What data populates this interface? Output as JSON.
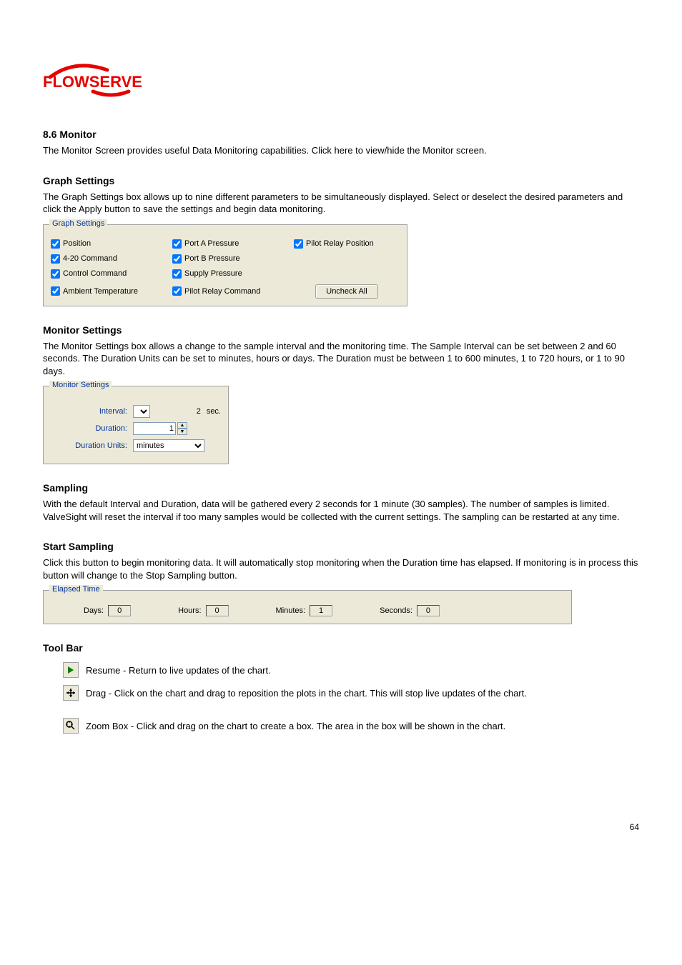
{
  "doc": {
    "section8_6_title": "8.6 Monitor",
    "intro": "The Monitor Screen provides useful Data Monitoring capabilities. Click here to view/hide the Monitor screen.",
    "graph_title": "Graph Settings",
    "graph_text": "The Graph Settings box allows up to nine different parameters to be simultaneously displayed. Select or deselect the desired parameters and click the Apply button to save the settings and begin data monitoring."
  },
  "graph": {
    "legend": "Graph Settings",
    "items": [
      {
        "label": "Position",
        "checked": true,
        "name": "chk-position"
      },
      {
        "label": "4-20 Command",
        "checked": true,
        "name": "chk-420-command"
      },
      {
        "label": "Control Command",
        "checked": true,
        "name": "chk-control-command"
      },
      {
        "label": "Ambient Temperature",
        "checked": true,
        "name": "chk-ambient-temperature"
      },
      {
        "label": "Port A Pressure",
        "checked": true,
        "name": "chk-port-a-pressure"
      },
      {
        "label": "Port B Pressure",
        "checked": true,
        "name": "chk-port-b-pressure"
      },
      {
        "label": "Supply Pressure",
        "checked": true,
        "name": "chk-supply-pressure"
      },
      {
        "label": "Pilot Relay Command",
        "checked": true,
        "name": "chk-pilot-relay-command"
      },
      {
        "label": "Pilot Relay Position",
        "checked": true,
        "name": "chk-pilot-relay-position"
      }
    ],
    "uncheck_all": "Uncheck All"
  },
  "monitor": {
    "legend": "Monitor Settings",
    "title": "Monitor Settings",
    "text": "The Monitor Settings box allows a change to the sample interval and the monitoring time. The Sample Interval can be set between 2 and 60 seconds. The Duration Units can be set to minutes, hours or days. The Duration must be between 1 to 600 minutes, 1 to 720 hours, or 1 to 90 days.",
    "interval_label": "Interval:",
    "interval_value": "2",
    "interval_unit": "sec.",
    "duration_label": "Duration:",
    "duration_value": "1",
    "duration_units_label": "Duration Units:",
    "duration_units_value": "minutes"
  },
  "sampling": {
    "title": "Sampling",
    "text": "With the default Interval and Duration, data will be gathered every 2 seconds for 1 minute (30 samples). The number of samples is limited. ValveSight will reset the interval if too many samples would be collected with the current settings. The sampling can be restarted at any time.",
    "title2": "Start Sampling",
    "text2": "Click this button to begin monitoring data.  It will automatically stop monitoring when the Duration time has elapsed.  If monitoring is in process this button will change to the Stop Sampling button."
  },
  "elapsed": {
    "legend": "Elapsed Time",
    "days_label": "Days:",
    "days_value": "0",
    "hours_label": "Hours:",
    "hours_value": "0",
    "minutes_label": "Minutes:",
    "minutes_value": "1",
    "seconds_label": "Seconds:",
    "seconds_value": "0"
  },
  "toolbar": {
    "title": "Tool Bar",
    "resume_label": "Resume - Return to live updates of the chart.",
    "drag_label": "Drag - Click on the chart and drag to reposition the plots in the chart.  This will stop live updates of the chart.",
    "zoom_label": "Zoom Box - Click and drag on the chart to create a box.  The area in the box will be shown in the chart."
  },
  "footer": {
    "pagenum": "64"
  }
}
